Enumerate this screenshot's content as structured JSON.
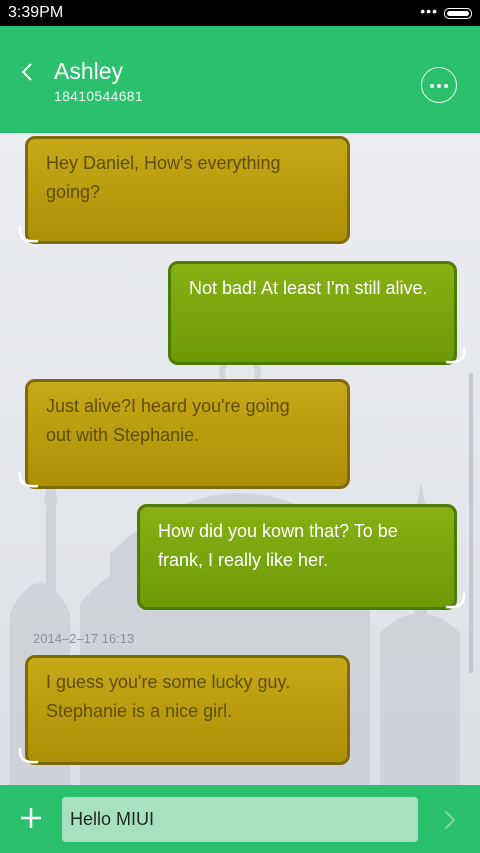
{
  "status_bar": {
    "time": "3:39PM",
    "dots": "•••",
    "battery_icon": "battery-icon"
  },
  "header": {
    "contact_name": "Ashley",
    "contact_number": "18410544681",
    "back_icon": "chevron-left-icon",
    "more_icon": "more-dots-icon"
  },
  "messages": [
    {
      "direction": "incoming",
      "text_lines": [
        "Hey Daniel, How's everything",
        "going?"
      ]
    },
    {
      "direction": "outgoing",
      "text_lines": [
        "Not bad! At least I'm still alive."
      ]
    },
    {
      "direction": "incoming",
      "text_lines": [
        "Just  alive?I heard you're going",
        "out with Stephanie."
      ]
    },
    {
      "direction": "outgoing",
      "text_lines": [
        "How did you kown that? To be",
        "frank, I really like her."
      ]
    },
    {
      "direction": "incoming",
      "text_lines": [
        "I guess you're some lucky guy.",
        "Stephanie is a nice girl."
      ]
    }
  ],
  "timestamp": "2014–2–17 16:13",
  "composer": {
    "input_value": "Hello MIUI",
    "add_icon": "plus-icon",
    "send_icon": "chevron-right-icon"
  },
  "colors": {
    "header": "#2bc06e",
    "incoming_bubble": "#c6a818",
    "outgoing_bubble": "#88b016"
  }
}
